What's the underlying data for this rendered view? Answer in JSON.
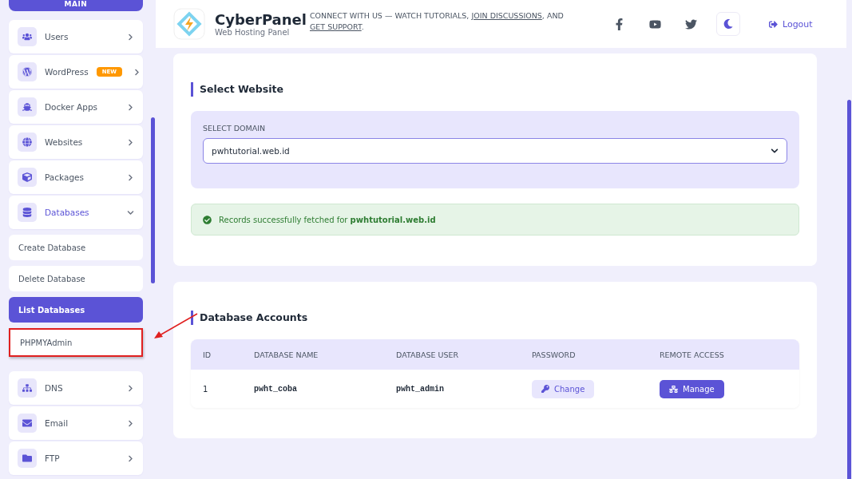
{
  "sidebar": {
    "section": "MAIN",
    "items": [
      {
        "label": "Users",
        "expanded": false
      },
      {
        "label": "WordPress",
        "badge": "NEW",
        "expanded": false
      },
      {
        "label": "Docker Apps",
        "expanded": false
      },
      {
        "label": "Websites",
        "expanded": false
      },
      {
        "label": "Packages",
        "expanded": false
      },
      {
        "label": "Databases",
        "expanded": true,
        "children": [
          {
            "label": "Create Database",
            "selected": false,
            "annotated": false
          },
          {
            "label": "Delete Database",
            "selected": false,
            "annotated": false
          },
          {
            "label": "List Databases",
            "selected": true,
            "annotated": false
          },
          {
            "label": "PHPMYAdmin",
            "selected": false,
            "annotated": true
          }
        ]
      },
      {
        "label": "DNS",
        "expanded": false
      },
      {
        "label": "Email",
        "expanded": false
      },
      {
        "label": "FTP",
        "expanded": false
      }
    ]
  },
  "header": {
    "brand": "CyberPanel",
    "tagline": "Web Hosting Panel",
    "message": [
      {
        "text": "CONNECT WITH US — WATCH TUTORIALS, ",
        "link": false
      },
      {
        "text": "JOIN DISCUSSIONS",
        "link": true
      },
      {
        "text": ", AND ",
        "link": false
      },
      {
        "text": "GET SUPPORT",
        "link": true
      },
      {
        "text": ".",
        "link": false
      }
    ],
    "logout": "Logout"
  },
  "select_card": {
    "title": "Select Website",
    "field_label": "SELECT DOMAIN",
    "value": "pwhtutorial.web.id",
    "alert": {
      "text": "Records successfully fetched for **pwhtutorial.web.id**"
    }
  },
  "accounts_card": {
    "title": "Database Accounts",
    "table": {
      "columns": [
        "ID",
        "DATABASE NAME",
        "DATABASE USER",
        "PASSWORD",
        "REMOTE ACCESS"
      ],
      "rows": [
        {
          "id": "1",
          "name": "pwht_coba",
          "user": "pwht_admin",
          "password_action": "Change",
          "remote_action": "Manage"
        }
      ]
    }
  }
}
